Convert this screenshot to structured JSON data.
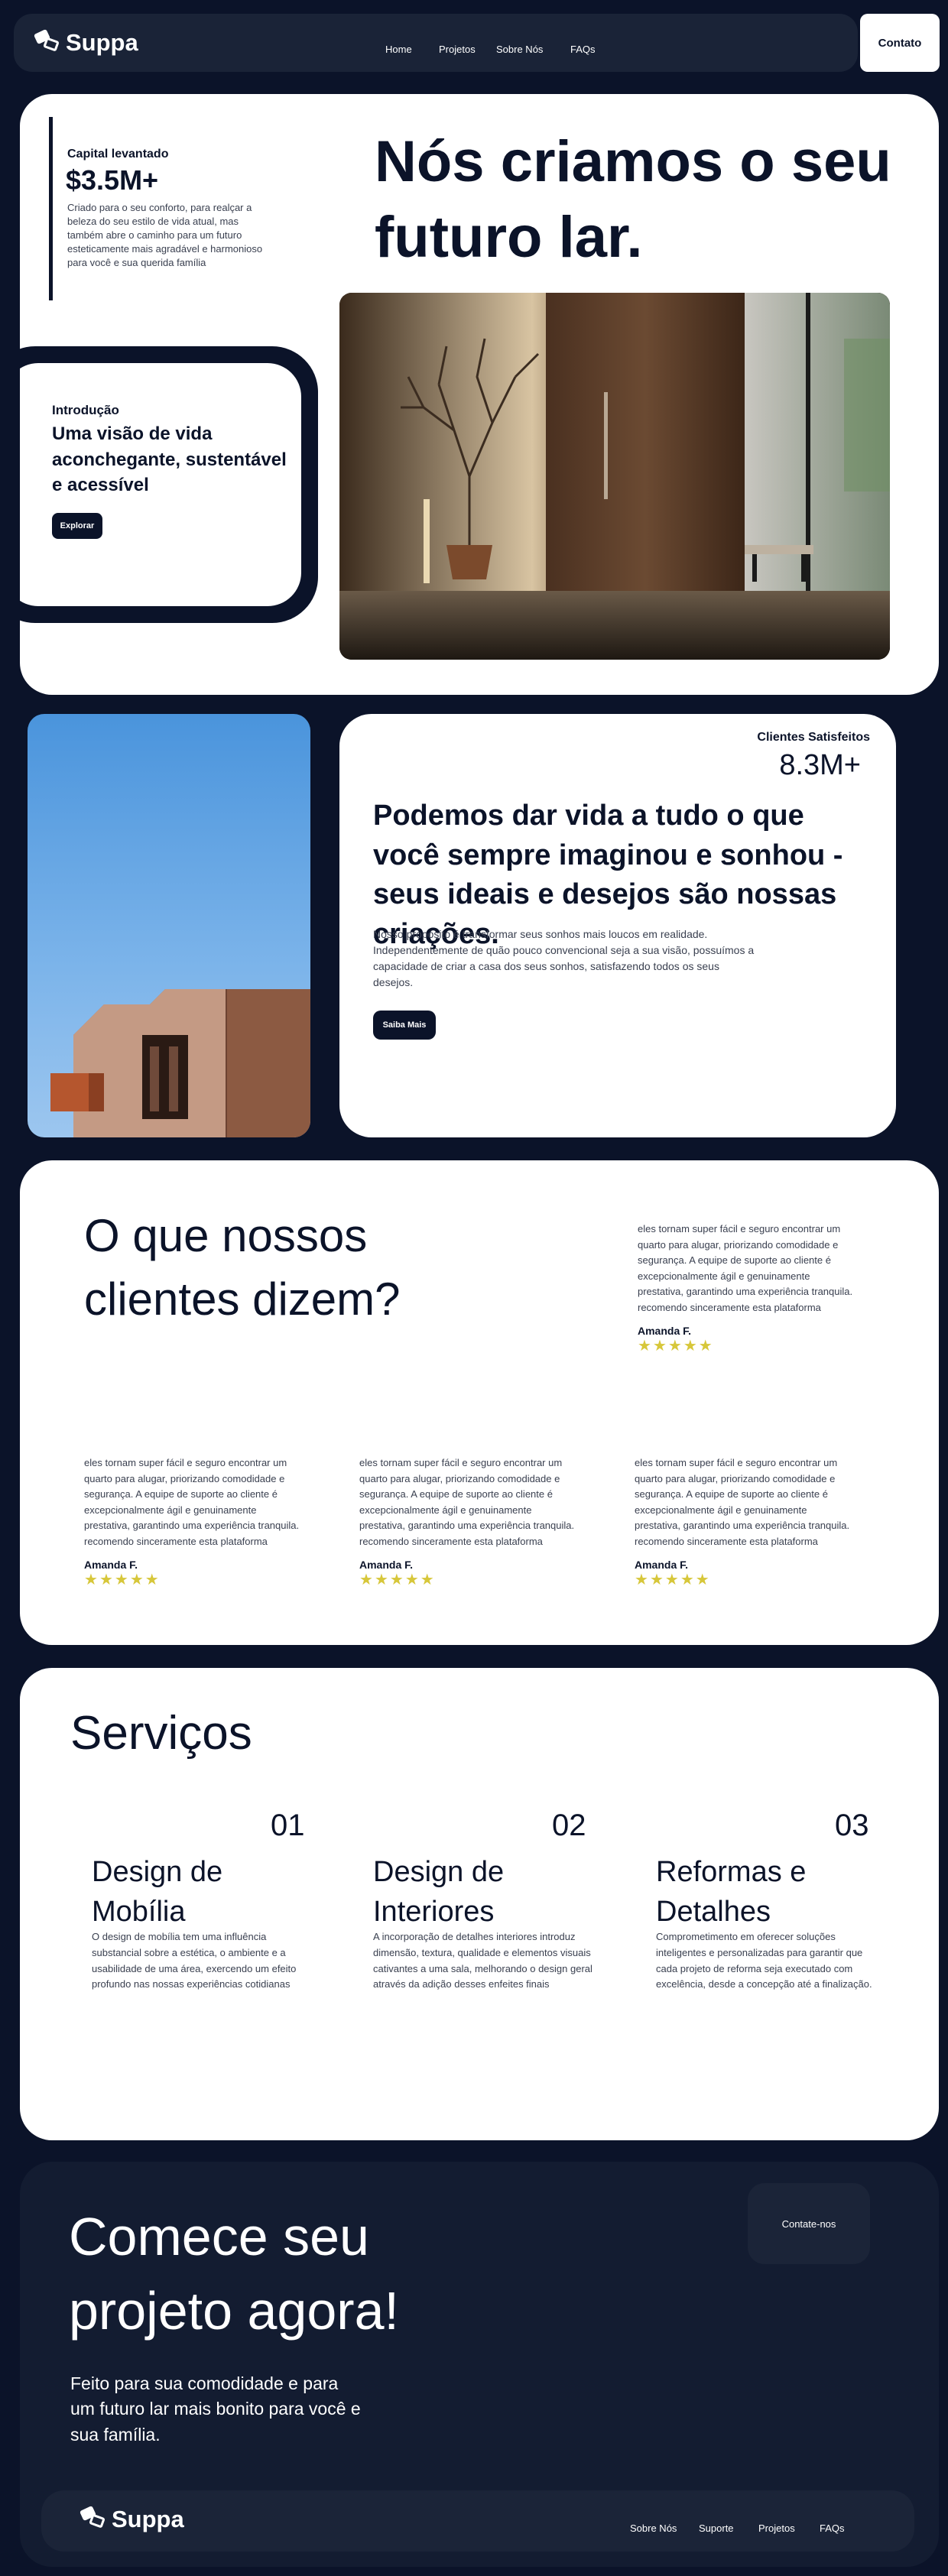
{
  "nav": {
    "brand": "Suppa",
    "links": [
      "Home",
      "Projetos",
      "Sobre Nós",
      "FAQs"
    ],
    "cta": "Contato"
  },
  "hero": {
    "capital_label": "Capital levantado",
    "capital_value": "$3.5M+",
    "capital_desc": "Criado para o seu conforto, para realçar a beleza do seu estilo de vida atual, mas também abre o caminho para um futuro esteticamente mais agradável e harmonioso para você e sua querida família",
    "intro_label": "Introdução",
    "intro_title": "Uma visão de vida aconchegante, sustentável e acessível",
    "intro_button": "Explorar",
    "title": "Nós criamos o seu futuro lar."
  },
  "about": {
    "stat_label": "Clientes Satisfeitos",
    "stat_value": "8.3M+",
    "title": "Podemos dar vida a tudo o que você sempre imaginou e sonhou - seus ideais e desejos são nossas criações.",
    "desc": "Nosso propósito é transformar seus sonhos mais loucos em realidade. Independentemente de quão pouco convencional seja a sua visão, possuímos a capacidade de criar a casa dos seus sonhos, satisfazendo todos os seus desejos.",
    "button": "Saiba Mais"
  },
  "testimonials": {
    "title": "O que nossos clientes dizem?",
    "items": [
      {
        "text": "eles tornam super fácil e seguro encontrar um quarto para alugar, priorizando comodidade e segurança. A equipe de suporte ao cliente é excepcionalmente ágil e genuinamente prestativa, garantindo uma experiência tranquila. recomendo sinceramente esta plataforma",
        "author": "Amanda F.",
        "rating": 5
      },
      {
        "text": "eles tornam super fácil e seguro encontrar um quarto para alugar, priorizando comodidade e segurança. A equipe de suporte ao cliente é excepcionalmente ágil e genuinamente prestativa, garantindo uma experiência tranquila. recomendo sinceramente esta plataforma",
        "author": "Amanda F.",
        "rating": 5
      },
      {
        "text": "eles tornam super fácil e seguro encontrar um quarto para alugar, priorizando comodidade e segurança. A equipe de suporte ao cliente é excepcionalmente ágil e genuinamente prestativa, garantindo uma experiência tranquila. recomendo sinceramente esta plataforma",
        "author": "Amanda F.",
        "rating": 5
      },
      {
        "text": "eles tornam super fácil e seguro encontrar um quarto para alugar, priorizando comodidade e segurança. A equipe de suporte ao cliente é excepcionalmente ágil e genuinamente prestativa, garantindo uma experiência tranquila. recomendo sinceramente esta plataforma",
        "author": "Amanda F.",
        "rating": 5
      }
    ]
  },
  "services": {
    "title": "Serviços",
    "items": [
      {
        "num": "01",
        "name": "Design de Mobília",
        "desc": "O design de mobília tem uma influência substancial sobre a estética, o ambiente e a usabilidade de uma área, exercendo um efeito profundo nas nossas experiências cotidianas"
      },
      {
        "num": "02",
        "name": "Design de Interiores",
        "desc": "A incorporação de detalhes interiores introduz dimensão, textura, qualidade e elementos visuais cativantes a uma sala, melhorando o design geral através da adição desses enfeites finais"
      },
      {
        "num": "03",
        "name": "Reformas e Detalhes",
        "desc": "Comprometimento em oferecer soluções inteligentes e personalizadas para garantir que cada projeto de reforma seja executado com excelência, desde a concepção até a finalização."
      }
    ]
  },
  "cta": {
    "title": "Comece seu projeto agora!",
    "desc": "Feito para sua comodidade e para um futuro lar mais bonito para você e sua família.",
    "button": "Contate-nos"
  },
  "footer": {
    "brand": "Suppa",
    "links": [
      "Sobre Nós",
      "Suporte",
      "Projetos",
      "FAQs"
    ]
  },
  "colors": {
    "background": "#0b1329",
    "card": "#ffffff",
    "star": "#d7c73a"
  }
}
